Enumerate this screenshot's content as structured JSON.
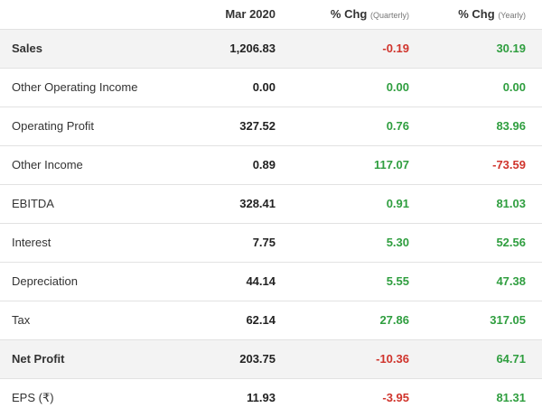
{
  "header": {
    "period": "Mar 2020",
    "qoq_label": "% Chg",
    "qoq_sub": "(Quarterly)",
    "yoy_label": "% Chg",
    "yoy_sub": "(Yearly)"
  },
  "rows": [
    {
      "metric": "Sales",
      "value": "1,206.83",
      "qoq": "-0.19",
      "yoy": "30.19",
      "highlight": true
    },
    {
      "metric": "Other Operating Income",
      "value": "0.00",
      "qoq": "0.00",
      "yoy": "0.00",
      "highlight": false
    },
    {
      "metric": "Operating Profit",
      "value": "327.52",
      "qoq": "0.76",
      "yoy": "83.96",
      "highlight": false
    },
    {
      "metric": "Other Income",
      "value": "0.89",
      "qoq": "117.07",
      "yoy": "-73.59",
      "highlight": false
    },
    {
      "metric": "EBITDA",
      "value": "328.41",
      "qoq": "0.91",
      "yoy": "81.03",
      "highlight": false
    },
    {
      "metric": "Interest",
      "value": "7.75",
      "qoq": "5.30",
      "yoy": "52.56",
      "highlight": false
    },
    {
      "metric": "Depreciation",
      "value": "44.14",
      "qoq": "5.55",
      "yoy": "47.38",
      "highlight": false
    },
    {
      "metric": "Tax",
      "value": "62.14",
      "qoq": "27.86",
      "yoy": "317.05",
      "highlight": false
    },
    {
      "metric": "Net Profit",
      "value": "203.75",
      "qoq": "-10.36",
      "yoy": "64.71",
      "highlight": true
    },
    {
      "metric": "EPS (₹)",
      "value": "11.93",
      "qoq": "-3.95",
      "yoy": "81.31",
      "highlight": false
    }
  ],
  "colors": {
    "positive": "#2f9e3f",
    "negative": "#d0342c",
    "highlight_bg": "#f3f3f3"
  }
}
